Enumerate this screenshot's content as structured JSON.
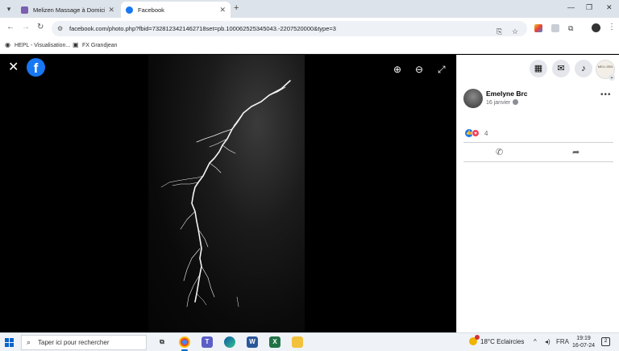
{
  "browser": {
    "tabs": [
      {
        "title": "Melizen Massage à Domicile N",
        "active": false
      },
      {
        "title": "Facebook",
        "active": true
      }
    ],
    "url": "facebook.com/photo.php?fbid=7328123421462718set=pb.100062525345043.-2207520000&type=3",
    "bookmarks": [
      {
        "label": "HEPL - Visualisation..."
      },
      {
        "label": "FX Grandjean"
      }
    ]
  },
  "post": {
    "author": "Emelyne Brc",
    "date": "16 janvier",
    "reaction_count": "4",
    "page_avatar_text": "MELI ZEN"
  },
  "taskbar": {
    "search_placeholder": "Taper ici pour rechercher",
    "weather": "18°C  Eclaircies",
    "language": "FRA",
    "time": "19:19",
    "date": "16-07-24"
  },
  "colors": {
    "facebook_blue": "#1877f2",
    "love_red": "#f33e58",
    "chrome_tabbar": "#dde3ea"
  }
}
